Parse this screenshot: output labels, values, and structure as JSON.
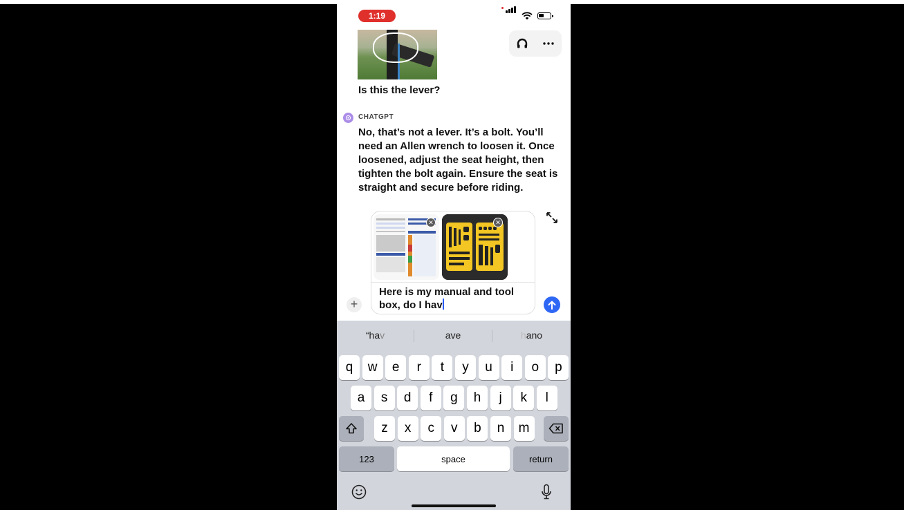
{
  "status": {
    "time": "1:19"
  },
  "chat": {
    "user_message": "Is this the lever?",
    "bot_name": "CHATGPT",
    "bot_message": "No, that’s not a lever. It’s a bolt. You’ll need an Allen wrench to loosen it. Once loosened, adjust the seat height, then tighten the bolt again. Ensure the seat is straight and secure before riding."
  },
  "composer": {
    "text": "Here is my manual and tool box, do I hav",
    "attachments": [
      "manual-image",
      "toolbox-image"
    ]
  },
  "keyboard": {
    "suggestions": [
      {
        "typed": "\"hav",
        "typed_main": "“ha",
        "typed_dim": "v"
      },
      {
        "typed_main": "ave",
        "typed_dim": ""
      },
      {
        "typed_dim": "h",
        "typed_main": "ano"
      }
    ],
    "row1": [
      "q",
      "w",
      "e",
      "r",
      "t",
      "y",
      "u",
      "i",
      "o",
      "p"
    ],
    "row2": [
      "a",
      "s",
      "d",
      "f",
      "g",
      "h",
      "j",
      "k",
      "l"
    ],
    "row3": [
      "z",
      "x",
      "c",
      "v",
      "b",
      "n",
      "m"
    ],
    "numbers_label": "123",
    "space_label": "space",
    "return_label": "return"
  },
  "icons": {
    "headphones": "headphones-icon",
    "more": "more-icon",
    "expand": "expand-icon",
    "close": "close-icon",
    "plus": "plus-icon",
    "send": "arrow-up-icon",
    "shift": "shift-icon",
    "backspace": "backspace-icon",
    "emoji": "emoji-icon",
    "mic": "microphone-icon"
  },
  "colors": {
    "record": "#e0302c",
    "send": "#2f67f5",
    "bot_avatar": "#ab8de8",
    "keyboard_bg": "#d2d5db"
  }
}
